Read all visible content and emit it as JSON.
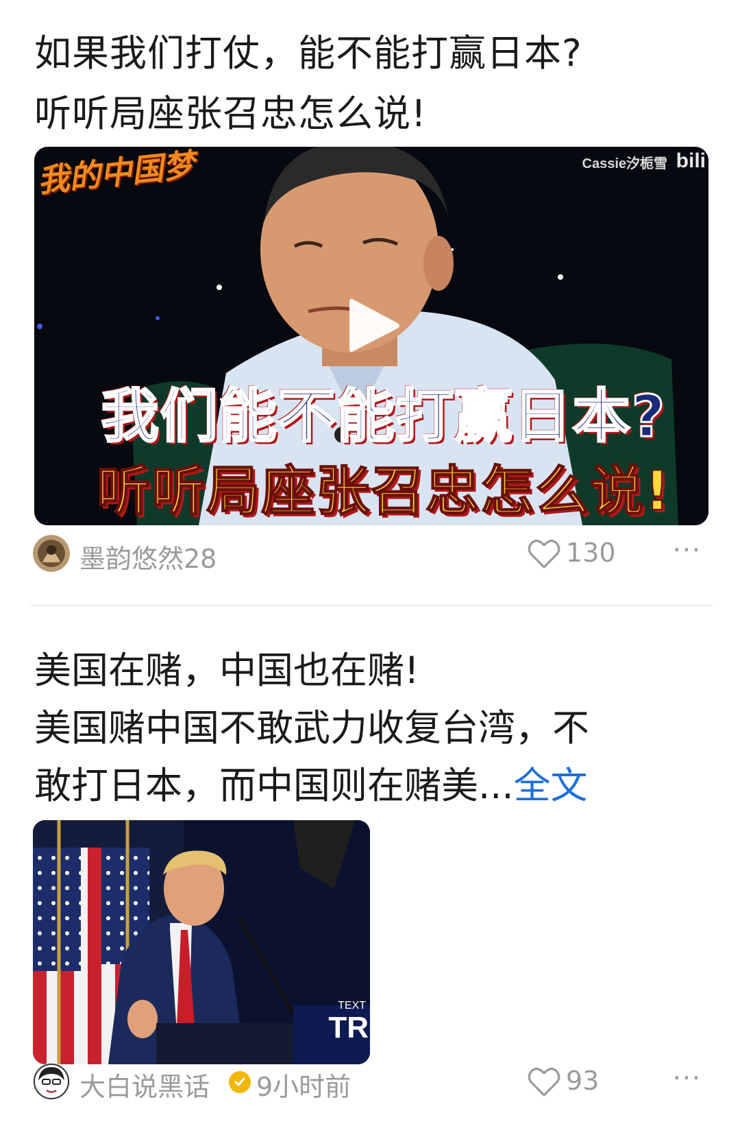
{
  "posts": [
    {
      "title_lines": [
        "如果我们打仗，能不能打赢日本?",
        "听听局座张召忠怎么说!"
      ],
      "video": {
        "watermark": "Cassie汐栀雪",
        "bili_logo": "bili",
        "show_logo": "我的中国梦",
        "caption_line1": "我们能不能打赢日本?",
        "caption_line2": "听听局座张召忠怎么说!"
      },
      "author": "墨韵悠然28",
      "likes": "130",
      "more": "···"
    },
    {
      "body_lines": [
        "美国在赌，中国也在赌!",
        "美国赌中国不敢武力收复台湾，不",
        "敢打日本，而中国则在赌美..."
      ],
      "more_link": "全文",
      "photo": {
        "sign_small": "TEXT",
        "sign_big": "TR"
      },
      "author": "大白说黑话",
      "time": "9小时前",
      "likes": "93",
      "more": "···"
    }
  ],
  "colors": {
    "link": "#1e6fd9",
    "meta_gray": "#9a9a9a",
    "verified": "#f2b705"
  },
  "icons": {
    "play": "play-icon",
    "like": "heart-outline-icon",
    "more": "more-horizontal-icon",
    "verified": "verified-badge-icon"
  }
}
